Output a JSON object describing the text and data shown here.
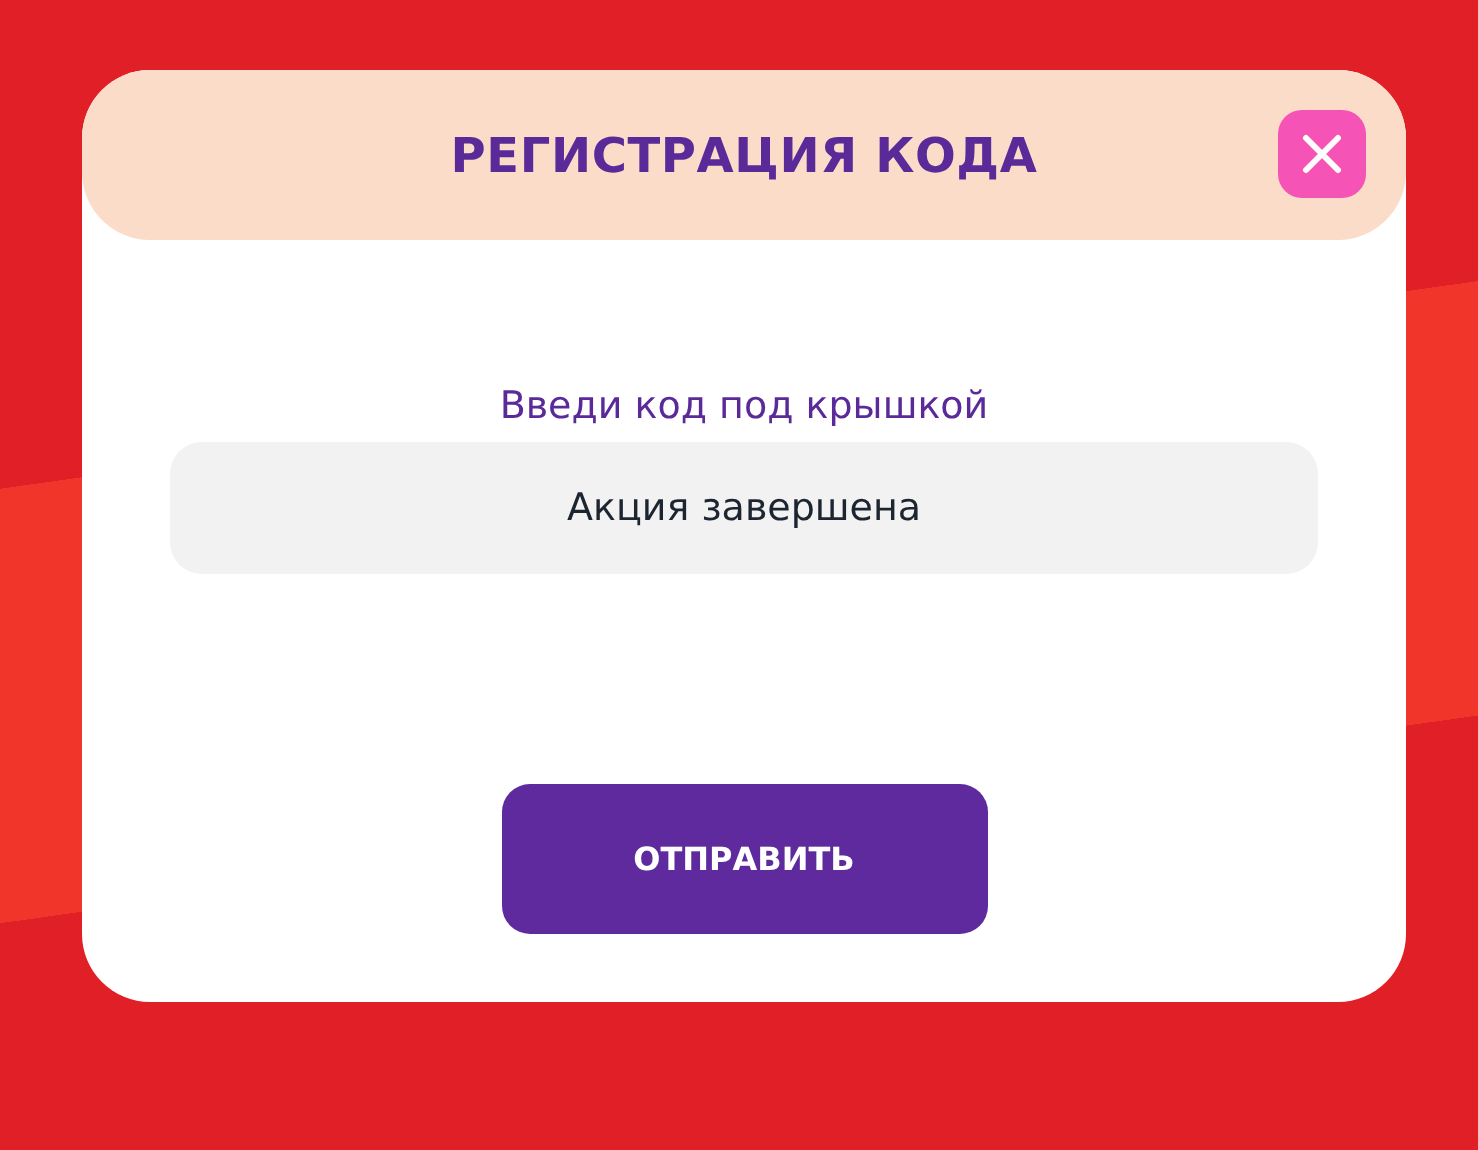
{
  "dialog": {
    "title": "РЕГИСТРАЦИЯ КОДА",
    "field": {
      "label": "Введи код под крышкой",
      "value": "Акция завершена"
    },
    "submit": {
      "label": "ОТПРАВИТЬ"
    }
  }
}
